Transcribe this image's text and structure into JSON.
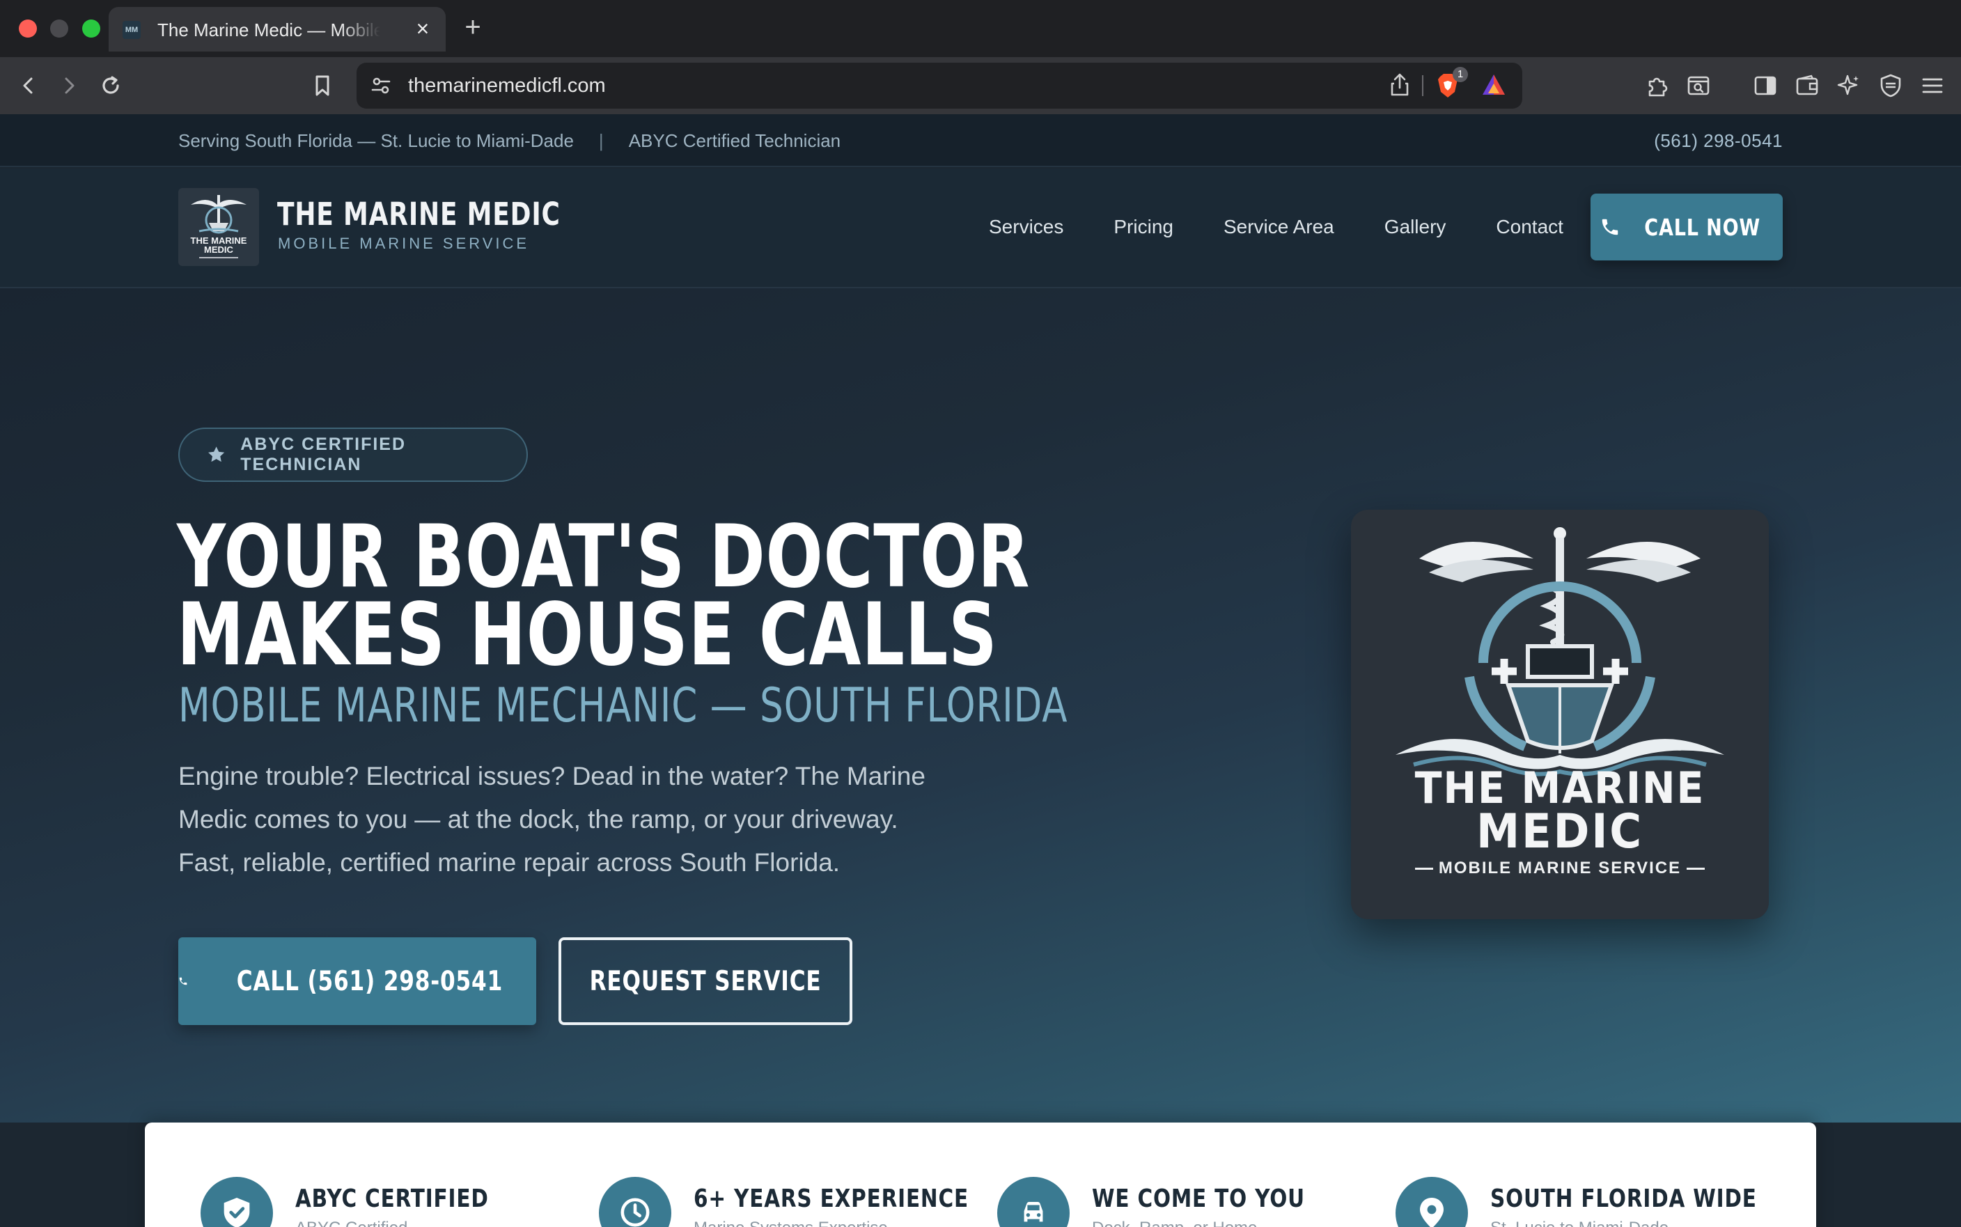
{
  "browser": {
    "tab_title": "The Marine Medic — Mobile Marine Service",
    "tab_favicon": "MM",
    "url": "themarinemedicfl.com",
    "brave_badge_count": "1"
  },
  "topbar": {
    "service_area": "Serving South Florida — St. Lucie to Miami-Dade",
    "separator": "|",
    "certification": "ABYC Certified Technician",
    "phone": "(561) 298-0541"
  },
  "header": {
    "brand_name": "THE MARINE MEDIC",
    "brand_tagline": "MOBILE MARINE SERVICE",
    "nav": [
      "Services",
      "Pricing",
      "Service Area",
      "Gallery",
      "Contact"
    ],
    "call_button": "CALL NOW"
  },
  "hero": {
    "badge": "ABYC CERTIFIED TECHNICIAN",
    "headline_1": "YOUR BOAT'S DOCTOR",
    "headline_2": "MAKES HOUSE CALLS",
    "subheadline": "MOBILE MARINE MECHANIC — SOUTH FLORIDA",
    "body": "Engine trouble? Electrical issues? Dead in the water? The Marine Medic comes to you — at the dock, the ramp, or your driveway. Fast, reliable, certified marine repair across South Florida.",
    "primary_button": "CALL (561) 298-0541",
    "secondary_button": "REQUEST SERVICE",
    "logo_card": {
      "title_1": "THE MARINE",
      "title_2": "MEDIC",
      "subtitle": "MOBILE MARINE SERVICE"
    }
  },
  "features": [
    {
      "title": "ABYC CERTIFIED",
      "description": "ABYC Certified",
      "icon": "shield-check-icon"
    },
    {
      "title": "6+ YEARS EXPERIENCE",
      "description": "Marine Systems Expertise",
      "icon": "clock-icon"
    },
    {
      "title": "WE COME TO YOU",
      "description": "Dock, Ramp, or Home",
      "icon": "car-icon"
    },
    {
      "title": "SOUTH FLORIDA WIDE",
      "description": "St. Lucie to Miami-Dade",
      "icon": "map-pin-icon"
    }
  ],
  "colors": {
    "accent": "#3a7a91",
    "header_bg": "#1b2935",
    "hero_light": "#376b80",
    "subheadline": "#7fb0c6"
  }
}
